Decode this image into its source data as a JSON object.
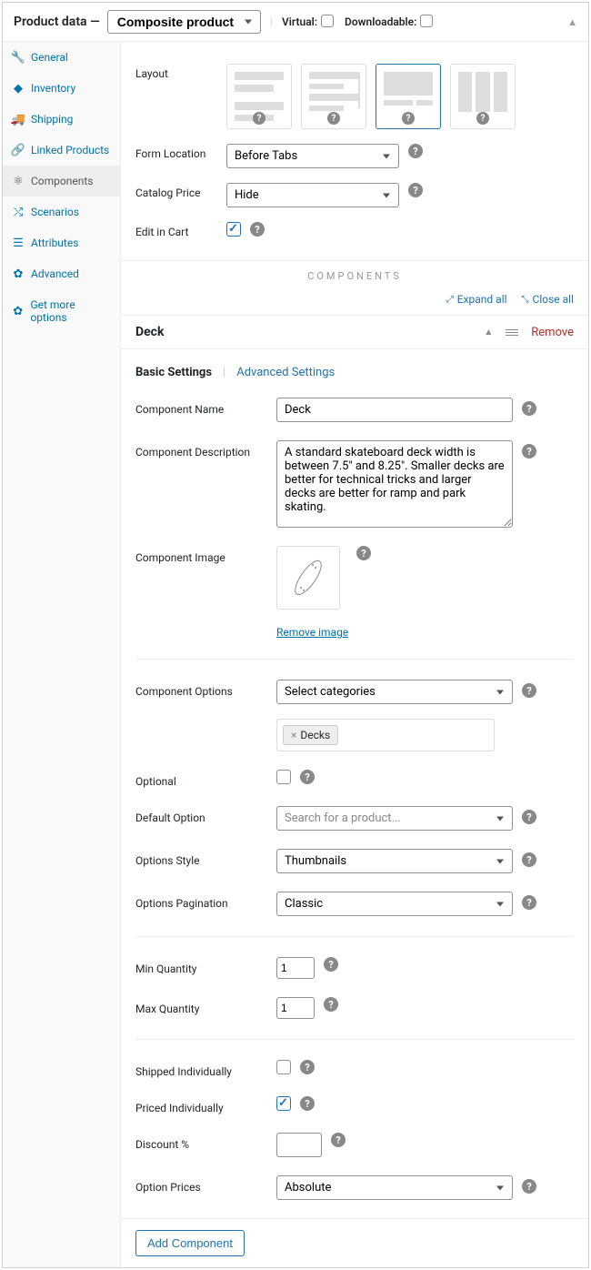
{
  "header": {
    "title": "Product data —",
    "productType": "Composite product",
    "virtualLabel": "Virtual:",
    "downloadableLabel": "Downloadable:"
  },
  "sidebar": {
    "items": [
      {
        "label": "General",
        "icon": "wrench"
      },
      {
        "label": "Inventory",
        "icon": "inventory"
      },
      {
        "label": "Shipping",
        "icon": "truck"
      },
      {
        "label": "Linked Products",
        "icon": "link"
      },
      {
        "label": "Components",
        "icon": "components",
        "active": true
      },
      {
        "label": "Scenarios",
        "icon": "shuffle"
      },
      {
        "label": "Attributes",
        "icon": "list"
      },
      {
        "label": "Advanced",
        "icon": "gear"
      },
      {
        "label": "Get more options",
        "icon": "gear"
      }
    ]
  },
  "layout": {
    "label": "Layout",
    "selectedIndex": 2
  },
  "formLocation": {
    "label": "Form Location",
    "value": "Before Tabs"
  },
  "catalogPrice": {
    "label": "Catalog Price",
    "value": "Hide"
  },
  "editInCart": {
    "label": "Edit in Cart",
    "checked": true
  },
  "sectionTitle": "COMPONENTS",
  "toolbar": {
    "expand": "Expand all",
    "close": "Close all"
  },
  "component": {
    "title": "Deck",
    "remove": "Remove",
    "tabs": {
      "basic": "Basic Settings",
      "advanced": "Advanced Settings"
    },
    "name": {
      "label": "Component Name",
      "value": "Deck"
    },
    "description": {
      "label": "Component Description",
      "value": "A standard skateboard deck width is between 7.5\" and 8.25\". Smaller decks are better for technical tricks and larger decks are better for ramp and park skating."
    },
    "image": {
      "label": "Component Image",
      "removeText": "Remove image"
    },
    "options": {
      "label": "Component Options",
      "value": "Select categories",
      "tag": "Decks"
    },
    "optional": {
      "label": "Optional"
    },
    "defaultOption": {
      "label": "Default Option",
      "placeholder": "Search for a product..."
    },
    "optionsStyle": {
      "label": "Options Style",
      "value": "Thumbnails"
    },
    "pagination": {
      "label": "Options Pagination",
      "value": "Classic"
    },
    "minQty": {
      "label": "Min Quantity",
      "value": "1"
    },
    "maxQty": {
      "label": "Max Quantity",
      "value": "1"
    },
    "shippedIndiv": {
      "label": "Shipped Individually",
      "checked": false
    },
    "pricedIndiv": {
      "label": "Priced Individually",
      "checked": true
    },
    "discount": {
      "label": "Discount %"
    },
    "optionPrices": {
      "label": "Option Prices",
      "value": "Absolute"
    }
  },
  "addButton": "Add Component"
}
